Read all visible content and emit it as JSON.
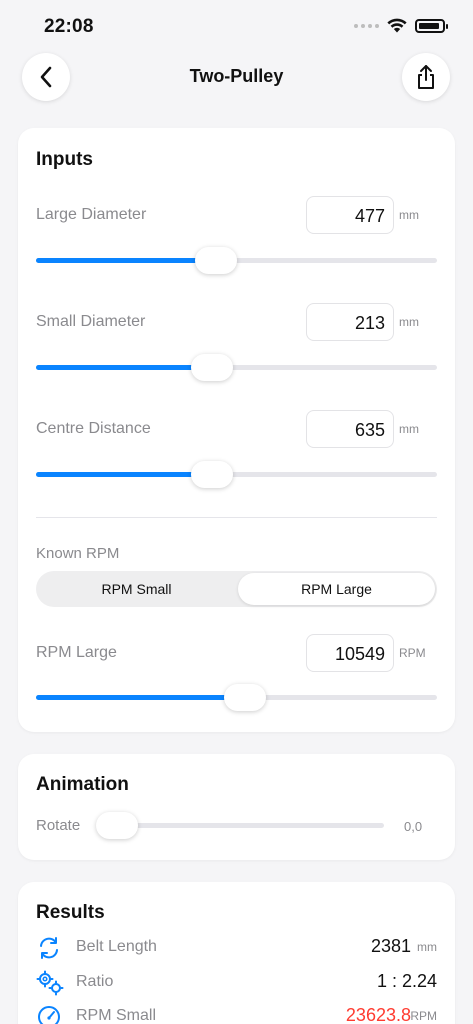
{
  "status_bar": {
    "time": "22:08"
  },
  "nav": {
    "title": "Two-Pulley"
  },
  "inputs": {
    "title": "Inputs",
    "large_diameter": {
      "label": "Large Diameter",
      "value": "477",
      "unit": "mm",
      "slider_fraction": 0.45
    },
    "small_diameter": {
      "label": "Small Diameter",
      "value": "213",
      "unit": "mm",
      "slider_fraction": 0.44
    },
    "centre_distance": {
      "label": "Centre Distance",
      "value": "635",
      "unit": "mm",
      "slider_fraction": 0.44
    },
    "known_rpm": {
      "label": "Known RPM",
      "options": [
        "RPM Small",
        "RPM Large"
      ],
      "selected": "RPM Large"
    },
    "rpm_large": {
      "label": "RPM Large",
      "value": "10549",
      "unit": "RPM",
      "slider_fraction": 0.52
    }
  },
  "animation": {
    "title": "Animation",
    "rotate_label": "Rotate",
    "rotate_value": "0,0",
    "slider_fraction": 0.0
  },
  "results": {
    "title": "Results",
    "belt_length": {
      "label": "Belt Length",
      "value": "2381",
      "unit": "mm"
    },
    "ratio": {
      "label": "Ratio",
      "value": "1 : 2.24"
    },
    "rpm_small": {
      "label": "RPM Small",
      "value": "23623.8",
      "unit": "RPM",
      "value_color": "#ff3b30"
    }
  },
  "colors": {
    "accent": "#0a84ff",
    "warning": "#ff3b30"
  }
}
